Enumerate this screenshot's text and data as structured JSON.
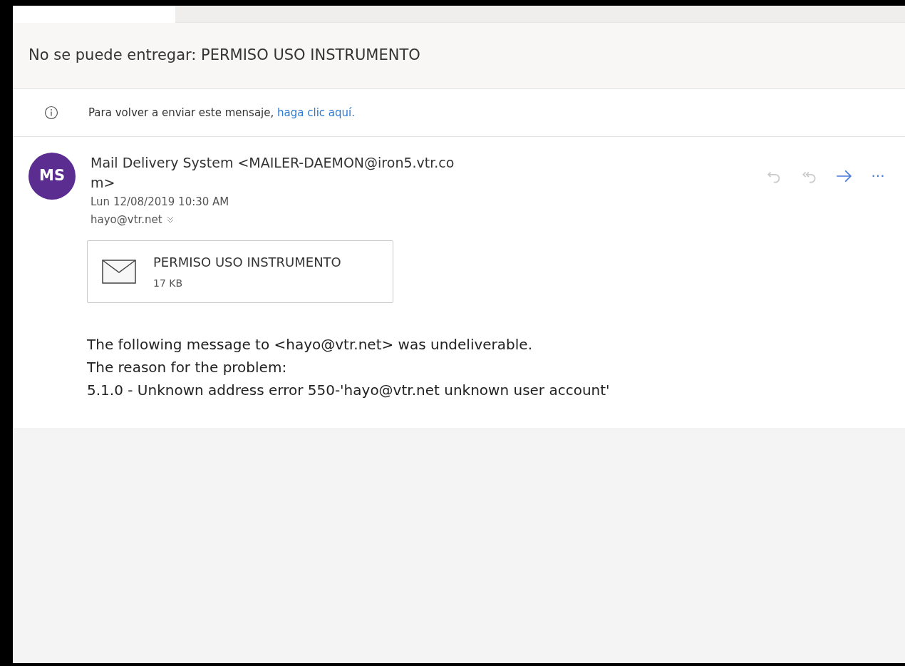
{
  "tabs": [
    {
      "selected": true
    }
  ],
  "subject": "No se puede entregar: PERMISO USO INSTRUMENTO",
  "infobar": {
    "text": "Para volver a enviar este mensaje, ",
    "link": "haga clic aquí."
  },
  "message": {
    "avatar": {
      "initials": "MS",
      "color": "#5c2d91"
    },
    "sender": "Mail Delivery System <MAILER-DAEMON@iron5.vtr.com>",
    "date": "Lun 12/08/2019 10:30 AM",
    "recipient": "hayo@vtr.net",
    "actions": [
      {
        "kind": "reply",
        "disabled": true
      },
      {
        "kind": "reply-all",
        "disabled": true
      },
      {
        "kind": "forward",
        "disabled": false
      },
      {
        "kind": "more",
        "label": "···",
        "disabled": false
      }
    ],
    "attachment": {
      "name": "PERMISO USO INSTRUMENTO",
      "size": "17 KB"
    },
    "body": [
      "The following message to <hayo@vtr.net> was undeliverable.",
      "The reason for the problem:",
      "5.1.0 - Unknown address error 550-'hayo@vtr.net unknown user account'"
    ]
  }
}
